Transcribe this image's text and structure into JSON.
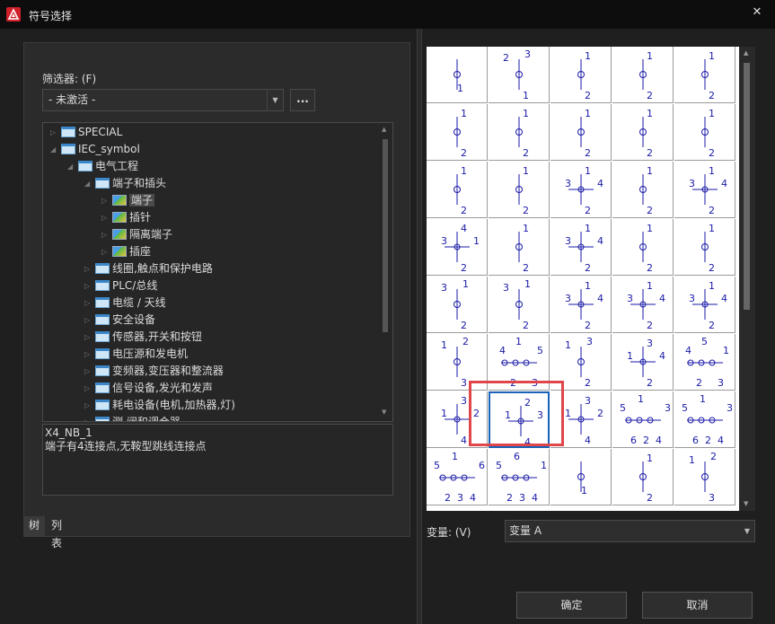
{
  "window": {
    "title": "符号选择",
    "close_glyph": "✕",
    "icon": "app-logo-icon",
    "accent": "#d0202a"
  },
  "filter": {
    "label": "筛选器: (F)",
    "value": "- 未激活 -",
    "more_label": "..."
  },
  "tree": [
    {
      "label": "SPECIAL",
      "icon": "folder-icon",
      "toggle": "▷"
    },
    {
      "label": "IEC_symbol",
      "icon": "folder-icon",
      "toggle": "◢"
    },
    {
      "label": "电气工程",
      "icon": "folder-icon",
      "toggle": "◢"
    },
    {
      "label": "端子和插头",
      "icon": "folder-icon",
      "toggle": "◢"
    },
    {
      "label": "端子",
      "icon": "symbol-icon",
      "toggle": "▷",
      "selected": true
    },
    {
      "label": "插针",
      "icon": "symbol-icon",
      "toggle": "▷"
    },
    {
      "label": "隔离端子",
      "icon": "symbol-icon",
      "toggle": "▷"
    },
    {
      "label": "插座",
      "icon": "symbol-icon",
      "toggle": "▷"
    },
    {
      "label": "线圈,触点和保护电路",
      "icon": "folder-icon",
      "toggle": "▷"
    },
    {
      "label": "PLC/总线",
      "icon": "folder-icon",
      "toggle": "▷"
    },
    {
      "label": "电缆 / 天线",
      "icon": "folder-icon",
      "toggle": "▷"
    },
    {
      "label": "安全设备",
      "icon": "folder-icon",
      "toggle": "▷"
    },
    {
      "label": "传感器,开关和按钮",
      "icon": "folder-icon",
      "toggle": "▷"
    },
    {
      "label": "电压源和发电机",
      "icon": "folder-icon",
      "toggle": "▷"
    },
    {
      "label": "变频器,变压器和整流器",
      "icon": "folder-icon",
      "toggle": "▷"
    },
    {
      "label": "信号设备,发光和发声",
      "icon": "folder-icon",
      "toggle": "▷"
    },
    {
      "label": "耗电设备(电机,加热器,灯)",
      "icon": "folder-icon",
      "toggle": "▷"
    },
    {
      "label": "测,阀和调合器",
      "icon": "folder-icon",
      "toggle": "▷"
    }
  ],
  "description": {
    "name": "X4_NB_1",
    "text": "端子有4连接点,无鞍型跳线连接点"
  },
  "view_tabs": [
    "树",
    "列表"
  ],
  "symbols": [
    {
      "labels": [
        "1"
      ]
    },
    {
      "labels": [
        "2",
        "3",
        "1"
      ]
    },
    {
      "labels": [
        "1",
        "2"
      ]
    },
    {
      "labels": [
        "1",
        "2"
      ]
    },
    {
      "labels": [
        "1",
        "2"
      ]
    },
    {
      "labels": [
        "1",
        "2"
      ]
    },
    {
      "labels": [
        "1",
        "2"
      ]
    },
    {
      "labels": [
        "1",
        "2"
      ]
    },
    {
      "labels": [
        "1",
        "2"
      ]
    },
    {
      "labels": [
        "1",
        "2"
      ]
    },
    {
      "labels": [
        "1",
        "2"
      ]
    },
    {
      "labels": [
        "1",
        "2"
      ]
    },
    {
      "labels": [
        "3",
        "1",
        "4",
        "2"
      ]
    },
    {
      "labels": [
        "1",
        "2"
      ]
    },
    {
      "labels": [
        "3",
        "1",
        "4",
        "2"
      ]
    },
    {
      "labels": [
        "3",
        "4",
        "1",
        "2"
      ]
    },
    {
      "labels": [
        "1",
        "2"
      ]
    },
    {
      "labels": [
        "3",
        "1",
        "4",
        "2"
      ]
    },
    {
      "labels": [
        "1",
        "2"
      ]
    },
    {
      "labels": [
        "1",
        "2"
      ]
    },
    {
      "labels": [
        "3",
        "1",
        "2"
      ]
    },
    {
      "labels": [
        "3",
        "1",
        "2"
      ]
    },
    {
      "labels": [
        "3",
        "1",
        "4",
        "2"
      ]
    },
    {
      "labels": [
        "3",
        "1",
        "4",
        "2"
      ]
    },
    {
      "labels": [
        "3",
        "1",
        "4",
        "2"
      ]
    },
    {
      "labels": [
        "1",
        "2",
        "3"
      ]
    },
    {
      "labels": [
        "4",
        "1",
        "5",
        "2",
        "3"
      ]
    },
    {
      "labels": [
        "1",
        "3",
        "2"
      ]
    },
    {
      "labels": [
        "1",
        "3",
        "4",
        "2"
      ]
    },
    {
      "labels": [
        "4",
        "5",
        "1",
        "2",
        "3"
      ]
    },
    {
      "labels": [
        "1",
        "3",
        "2",
        "4"
      ]
    },
    {
      "labels": [
        "1",
        "2",
        "3",
        "4"
      ],
      "selected": true
    },
    {
      "labels": [
        "1",
        "3",
        "2",
        "4"
      ]
    },
    {
      "labels": [
        "5",
        "1",
        "3",
        "6",
        "2",
        "4"
      ]
    },
    {
      "labels": [
        "5",
        "1",
        "3",
        "6",
        "2",
        "4"
      ]
    },
    {
      "labels": [
        "5",
        "1",
        "6",
        "2",
        "3",
        "4"
      ]
    },
    {
      "labels": [
        "5",
        "6",
        "1",
        "2",
        "3",
        "4"
      ]
    },
    {
      "labels": [
        "1"
      ]
    },
    {
      "labels": [
        "1",
        "2"
      ]
    },
    {
      "labels": [
        "1",
        "2",
        "3"
      ]
    }
  ],
  "symbol_color": "#1a1aa8",
  "variant": {
    "label": "变量: (V)",
    "value": "变量 A"
  },
  "buttons": {
    "ok": "确定",
    "cancel": "取消"
  }
}
